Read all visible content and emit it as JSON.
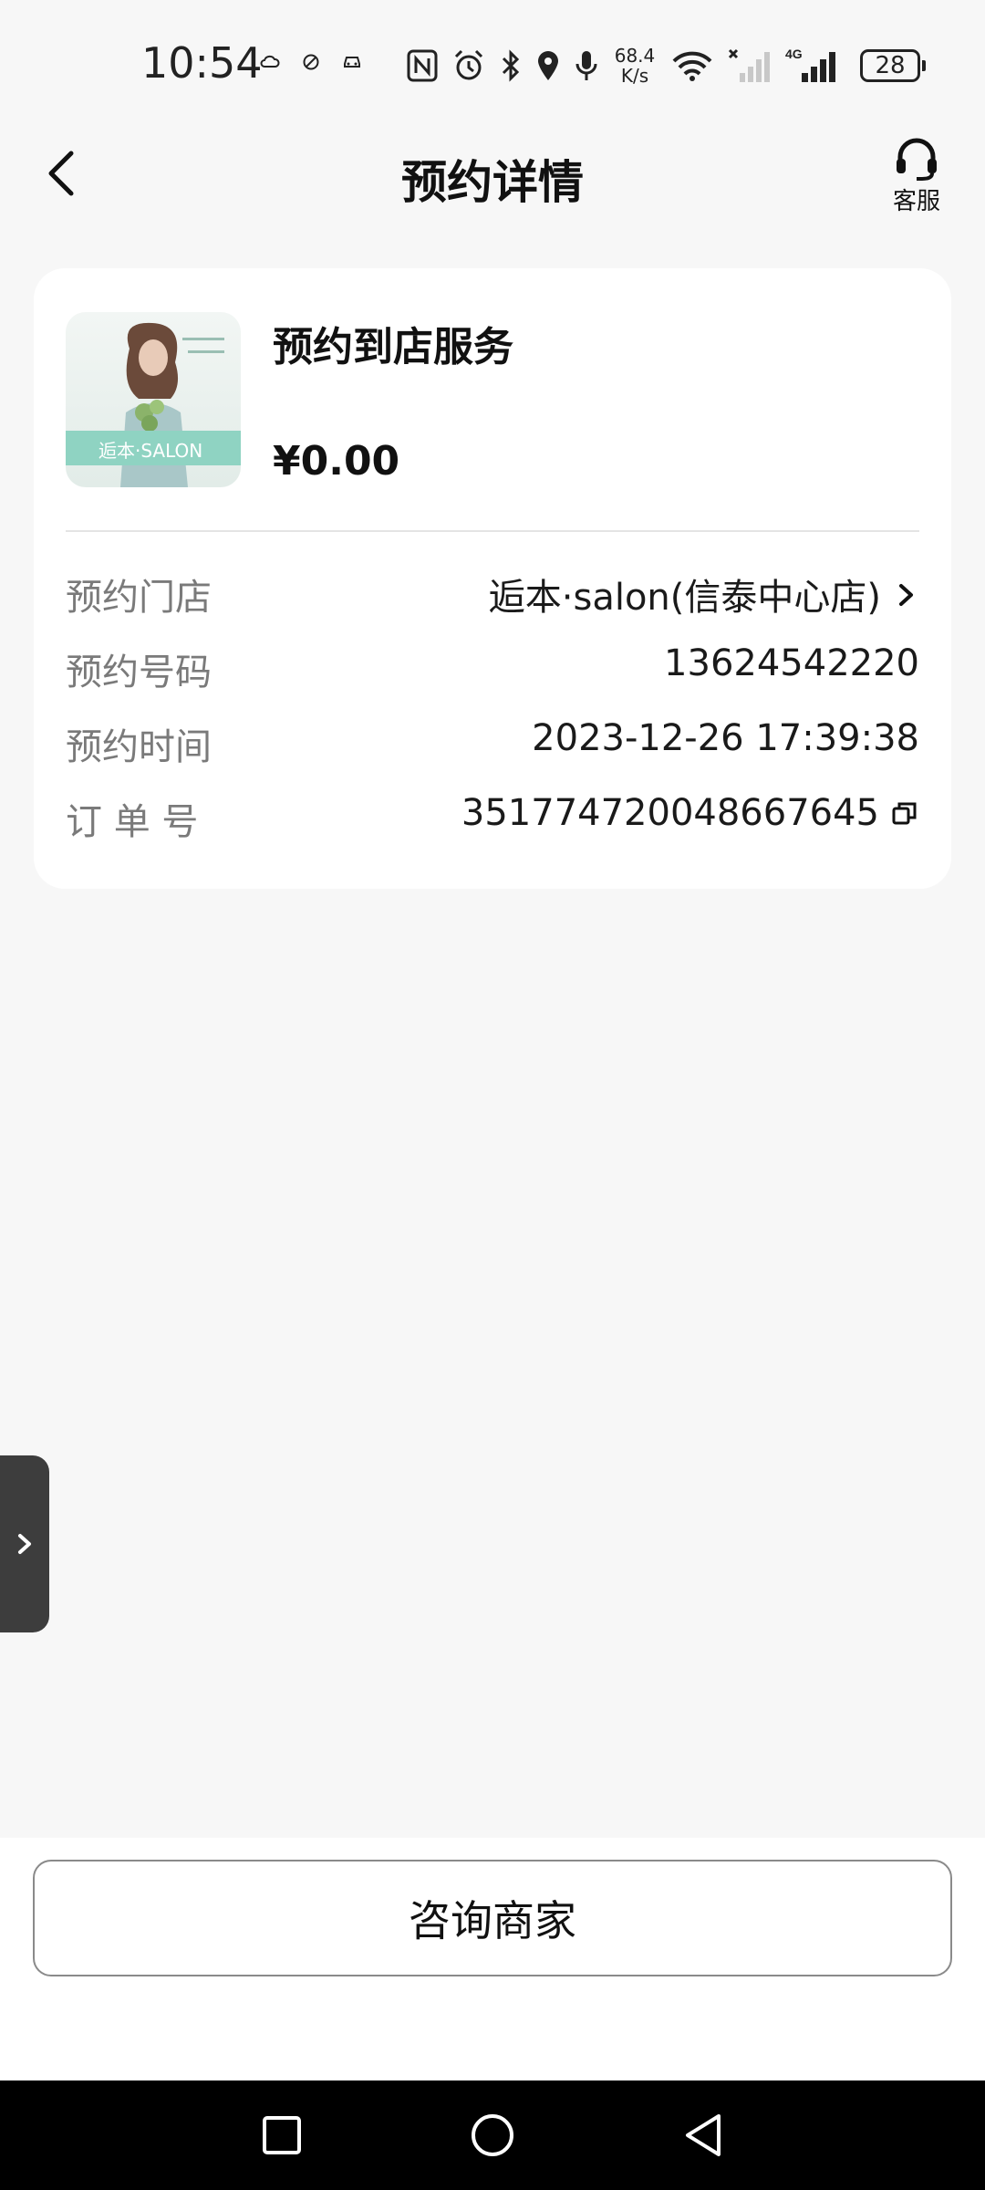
{
  "status_bar": {
    "time": "10:54",
    "net_speed_value": "68.4",
    "net_speed_unit": "K/s",
    "network_type": "4G",
    "battery_level": "28",
    "icons": [
      "cloud-icon",
      "blocked-icon",
      "car-icon",
      "nfc-icon",
      "alarm-icon",
      "bluetooth-icon",
      "location-icon",
      "microphone-icon",
      "wifi-icon",
      "signal-no-service-icon",
      "signal-4g-icon",
      "battery-icon"
    ]
  },
  "header": {
    "title": "预约详情",
    "back_icon": "chevron-left-icon",
    "service_icon": "headset-icon",
    "service_label": "客服"
  },
  "card": {
    "product": {
      "image_brand_text": "逅本·SALON",
      "name": "预约到店服务",
      "price": "¥0.00"
    },
    "rows": [
      {
        "label": "预约门店",
        "value": "逅本·salon(信泰中心店)",
        "trailing_icon": "chevron-right-icon"
      },
      {
        "label": "预约号码",
        "value": "13624542220"
      },
      {
        "label": "预约时间",
        "value": "2023-12-26 17:39:38"
      },
      {
        "label": "订 单 号",
        "value": "351774720048667645",
        "trailing_icon": "copy-icon"
      }
    ]
  },
  "side_tab": {
    "icon": "chevron-right-icon"
  },
  "bottom": {
    "consult_label": "咨询商家"
  },
  "nav_bar": {
    "icons": [
      "recent-apps-icon",
      "home-icon",
      "back-icon"
    ]
  },
  "colors": {
    "background": "#f7f7f7",
    "card": "#ffffff",
    "label_gray": "#7a7a7a",
    "text": "#1a1a1a",
    "nav_bar": "#000000"
  }
}
